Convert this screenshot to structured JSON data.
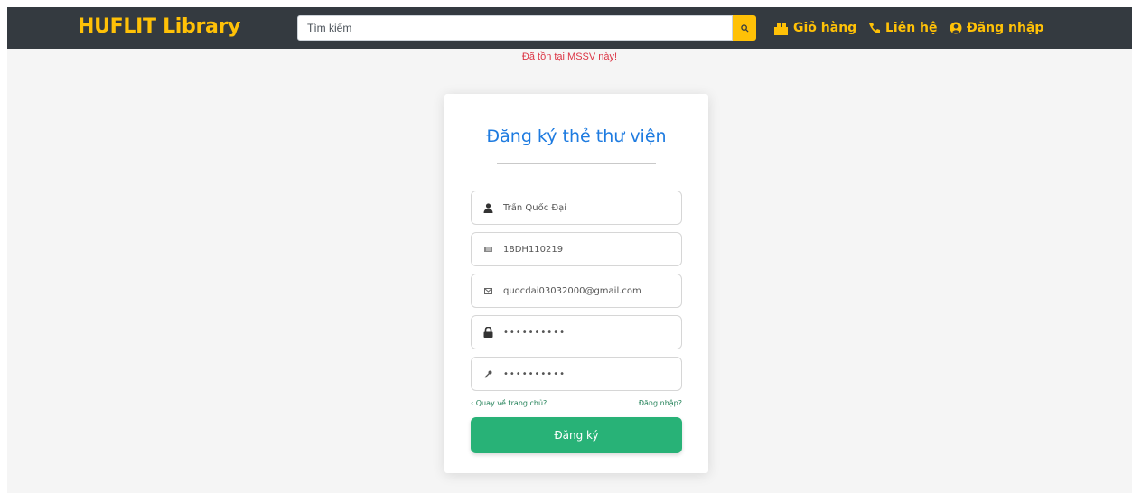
{
  "navbar": {
    "brand": "HUFLIT Library",
    "search": {
      "placeholder": "Tìm kiếm",
      "value": ""
    },
    "search_button_icon": "search-icon",
    "links": [
      {
        "label": "Giỏ hàng",
        "icon": "cart-icon"
      },
      {
        "label": "Liên hệ",
        "icon": "phone-icon"
      },
      {
        "label": "Đăng nhập",
        "icon": "user-circle-icon"
      }
    ]
  },
  "error": "Đã tồn tại MSSV này!",
  "form": {
    "title": "Đăng ký thẻ thư viện",
    "fields": [
      {
        "icon": "user-icon",
        "value": "Trần Quốc Đại",
        "type": "text"
      },
      {
        "icon": "id-card-icon",
        "value": "18DH110219",
        "type": "text"
      },
      {
        "icon": "envelope-icon",
        "value": "quocdai03032000@gmail.com",
        "type": "text"
      },
      {
        "icon": "lock-icon",
        "value": "••••••••••",
        "type": "password"
      },
      {
        "icon": "key-icon",
        "value": "••••••••••",
        "type": "password"
      }
    ],
    "back_link": "‹ Quay về trang chủ?",
    "login_link": "Đăng nhập?",
    "submit_label": "Đăng ký"
  },
  "colors": {
    "navbar_bg": "#343a40",
    "accent": "#ffc107",
    "title": "#1e7be0",
    "error": "#dc3545",
    "submit": "#28b277",
    "link": "#1f7f55"
  }
}
